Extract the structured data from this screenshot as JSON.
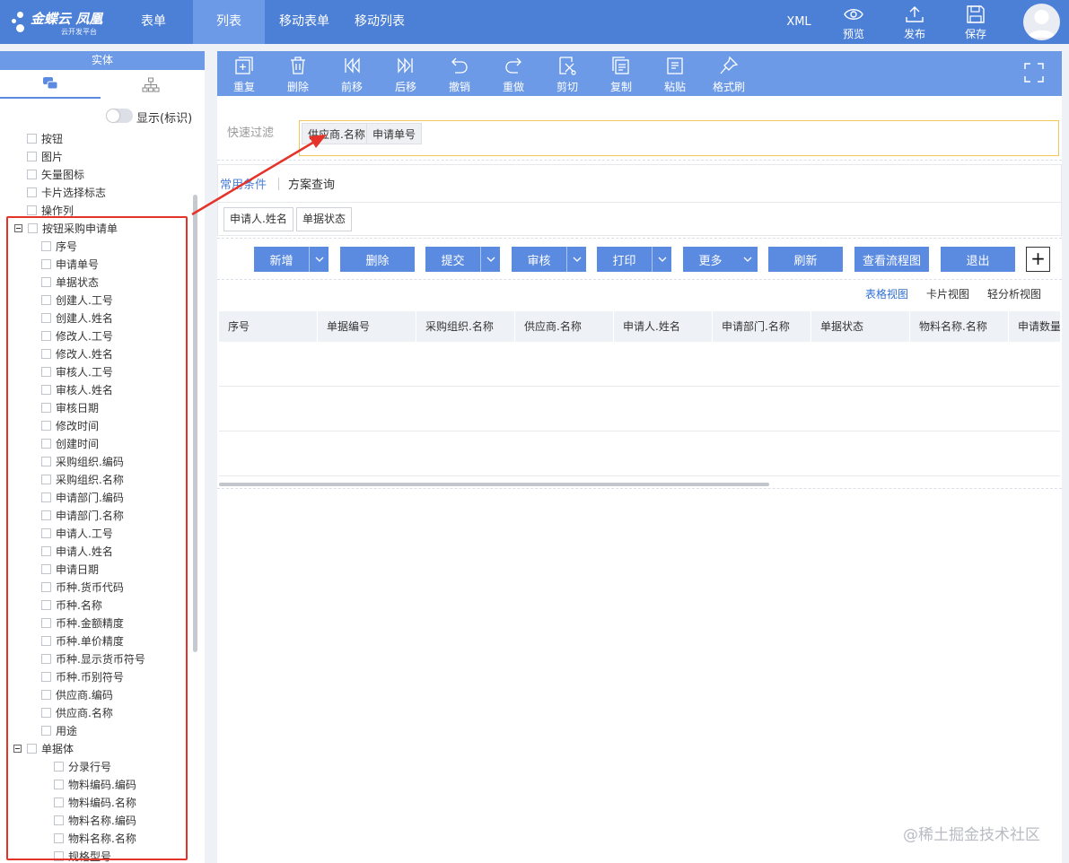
{
  "brand": {
    "name": "金蝶云 凤凰",
    "subtitle": "云开发平台"
  },
  "nav": {
    "tabs": [
      {
        "label": "表单",
        "active": false
      },
      {
        "label": "列表",
        "active": true
      },
      {
        "label": "移动表单",
        "active": false
      },
      {
        "label": "移动列表",
        "active": false
      }
    ],
    "xml_label": "XML",
    "actions": [
      {
        "label": "预览",
        "icon": "eye-icon"
      },
      {
        "label": "发布",
        "icon": "upload-icon"
      },
      {
        "label": "保存",
        "icon": "save-icon"
      }
    ]
  },
  "left_panel": {
    "title": "实体",
    "toggle_label": "显示(标识)",
    "tree": [
      {
        "label": "按钮",
        "level": 1,
        "expander": false
      },
      {
        "label": "图片",
        "level": 1,
        "expander": false
      },
      {
        "label": "矢量图标",
        "level": 1,
        "expander": false
      },
      {
        "label": "卡片选择标志",
        "level": 1,
        "expander": false
      },
      {
        "label": "操作列",
        "level": 1,
        "expander": false
      },
      {
        "label": "按钮采购申请单",
        "level": 0,
        "expander": true
      },
      {
        "label": "序号",
        "level": 2,
        "expander": false
      },
      {
        "label": "申请单号",
        "level": 2,
        "expander": false
      },
      {
        "label": "单据状态",
        "level": 2,
        "expander": false
      },
      {
        "label": "创建人.工号",
        "level": 2,
        "expander": false
      },
      {
        "label": "创建人.姓名",
        "level": 2,
        "expander": false
      },
      {
        "label": "修改人.工号",
        "level": 2,
        "expander": false
      },
      {
        "label": "修改人.姓名",
        "level": 2,
        "expander": false
      },
      {
        "label": "审核人.工号",
        "level": 2,
        "expander": false
      },
      {
        "label": "审核人.姓名",
        "level": 2,
        "expander": false
      },
      {
        "label": "审核日期",
        "level": 2,
        "expander": false
      },
      {
        "label": "修改时间",
        "level": 2,
        "expander": false
      },
      {
        "label": "创建时间",
        "level": 2,
        "expander": false
      },
      {
        "label": "采购组织.编码",
        "level": 2,
        "expander": false
      },
      {
        "label": "采购组织.名称",
        "level": 2,
        "expander": false
      },
      {
        "label": "申请部门.编码",
        "level": 2,
        "expander": false
      },
      {
        "label": "申请部门.名称",
        "level": 2,
        "expander": false
      },
      {
        "label": "申请人.工号",
        "level": 2,
        "expander": false
      },
      {
        "label": "申请人.姓名",
        "level": 2,
        "expander": false
      },
      {
        "label": "申请日期",
        "level": 2,
        "expander": false
      },
      {
        "label": "币种.货币代码",
        "level": 2,
        "expander": false
      },
      {
        "label": "币种.名称",
        "level": 2,
        "expander": false
      },
      {
        "label": "币种.金额精度",
        "level": 2,
        "expander": false
      },
      {
        "label": "币种.单价精度",
        "level": 2,
        "expander": false
      },
      {
        "label": "币种.显示货币符号",
        "level": 2,
        "expander": false
      },
      {
        "label": "币种.币别符号",
        "level": 2,
        "expander": false
      },
      {
        "label": "供应商.编码",
        "level": 2,
        "expander": false
      },
      {
        "label": "供应商.名称",
        "level": 2,
        "expander": false
      },
      {
        "label": "用途",
        "level": 2,
        "expander": false
      },
      {
        "label": "单据体",
        "level": 1.5,
        "expander": true
      },
      {
        "label": "分录行号",
        "level": 3,
        "expander": false
      },
      {
        "label": "物料编码.编码",
        "level": 3,
        "expander": false
      },
      {
        "label": "物料编码.名称",
        "level": 3,
        "expander": false
      },
      {
        "label": "物料名称.编码",
        "level": 3,
        "expander": false
      },
      {
        "label": "物料名称.名称",
        "level": 3,
        "expander": false
      },
      {
        "label": "规格型号",
        "level": 3,
        "expander": false
      }
    ]
  },
  "toolbar": {
    "buttons": [
      {
        "label": "重复",
        "icon": "duplicate-icon"
      },
      {
        "label": "删除",
        "icon": "trash-icon"
      },
      {
        "label": "前移",
        "icon": "move-forward-icon"
      },
      {
        "label": "后移",
        "icon": "move-back-icon"
      },
      {
        "label": "撤销",
        "icon": "undo-icon"
      },
      {
        "label": "重做",
        "icon": "redo-icon"
      },
      {
        "label": "剪切",
        "icon": "cut-icon"
      },
      {
        "label": "复制",
        "icon": "copy-icon"
      },
      {
        "label": "粘贴",
        "icon": "paste-icon"
      },
      {
        "label": "格式刷",
        "icon": "format-brush-icon"
      }
    ]
  },
  "filter": {
    "label": "快速过滤",
    "chips": [
      "供应商.名称",
      "申请单号"
    ]
  },
  "scheme": {
    "tabs": [
      {
        "label": "常用条件",
        "active": true
      },
      {
        "label": "方案查询",
        "active": false
      }
    ],
    "conditions": [
      "申请人.姓名",
      "单据状态"
    ]
  },
  "actions": [
    {
      "label": "新增",
      "dropdown": true
    },
    {
      "label": "删除",
      "dropdown": false
    },
    {
      "label": "提交",
      "dropdown": true
    },
    {
      "label": "审核",
      "dropdown": true
    },
    {
      "label": "打印",
      "dropdown": true
    },
    {
      "label": "更多",
      "dropdown": true
    },
    {
      "label": "刷新",
      "dropdown": false
    },
    {
      "label": "查看流程图",
      "dropdown": false
    },
    {
      "label": "退出",
      "dropdown": false
    }
  ],
  "plus_label": "+",
  "views": [
    {
      "label": "表格视图",
      "active": true
    },
    {
      "label": "卡片视图",
      "active": false
    },
    {
      "label": "轻分析视图",
      "active": false
    }
  ],
  "grid": {
    "columns": [
      "序号",
      "单据编号",
      "采购组织.名称",
      "供应商.名称",
      "申请人.姓名",
      "申请部门.名称",
      "单据状态",
      "物料名称.名称",
      "申请数量"
    ],
    "empty_rows": 3
  },
  "watermark": "@稀土掘金技术社区",
  "colors": {
    "topbar": "#4c7fd6",
    "accent": "#5b8be0",
    "annotation_red": "#e5332a"
  }
}
